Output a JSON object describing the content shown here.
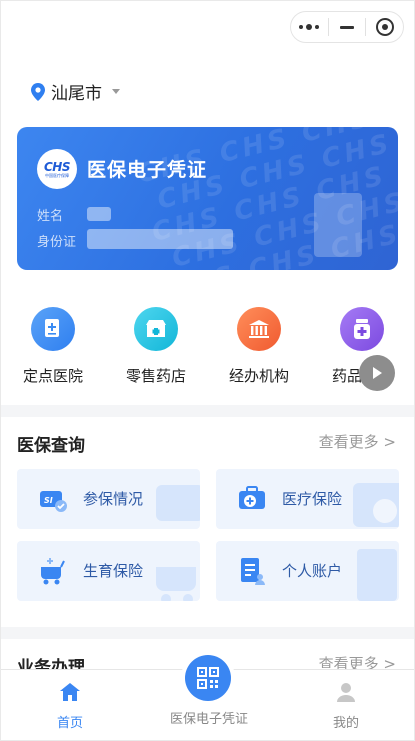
{
  "location": {
    "city": "汕尾市"
  },
  "card": {
    "logo_text": "CHS",
    "logo_subtext": "中国医疗保障",
    "title": "医保电子凭证",
    "name_label": "姓名",
    "id_label": "身份证"
  },
  "shortcuts": [
    {
      "label": "定点医院",
      "icon": "hospital-icon",
      "color": "#3b8cf3"
    },
    {
      "label": "零售药店",
      "icon": "pharmacy-icon",
      "color": "#1fc2e0"
    },
    {
      "label": "经办机构",
      "icon": "institution-icon",
      "color": "#f5683a"
    },
    {
      "label": "药品目录",
      "icon": "medicine-icon",
      "color": "#8a5ae6"
    }
  ],
  "query_section": {
    "title": "医保查询",
    "more": "查看更多 >",
    "tiles": [
      {
        "label": "参保情况",
        "icon": "insurance-status-icon"
      },
      {
        "label": "医疗保险",
        "icon": "medical-kit-icon"
      },
      {
        "label": "生育保险",
        "icon": "stroller-icon"
      },
      {
        "label": "个人账户",
        "icon": "account-document-icon"
      }
    ]
  },
  "business_section": {
    "title": "业务办理",
    "more": "查看更多 >"
  },
  "bottom_nav": {
    "home": "首页",
    "center": "医保电子凭证",
    "mine": "我的"
  },
  "colors": {
    "accent": "#3a86f2",
    "active_nav": "#3a86f2",
    "tile_bg": "#eef4fd",
    "tile_text": "#2e5aa6"
  }
}
